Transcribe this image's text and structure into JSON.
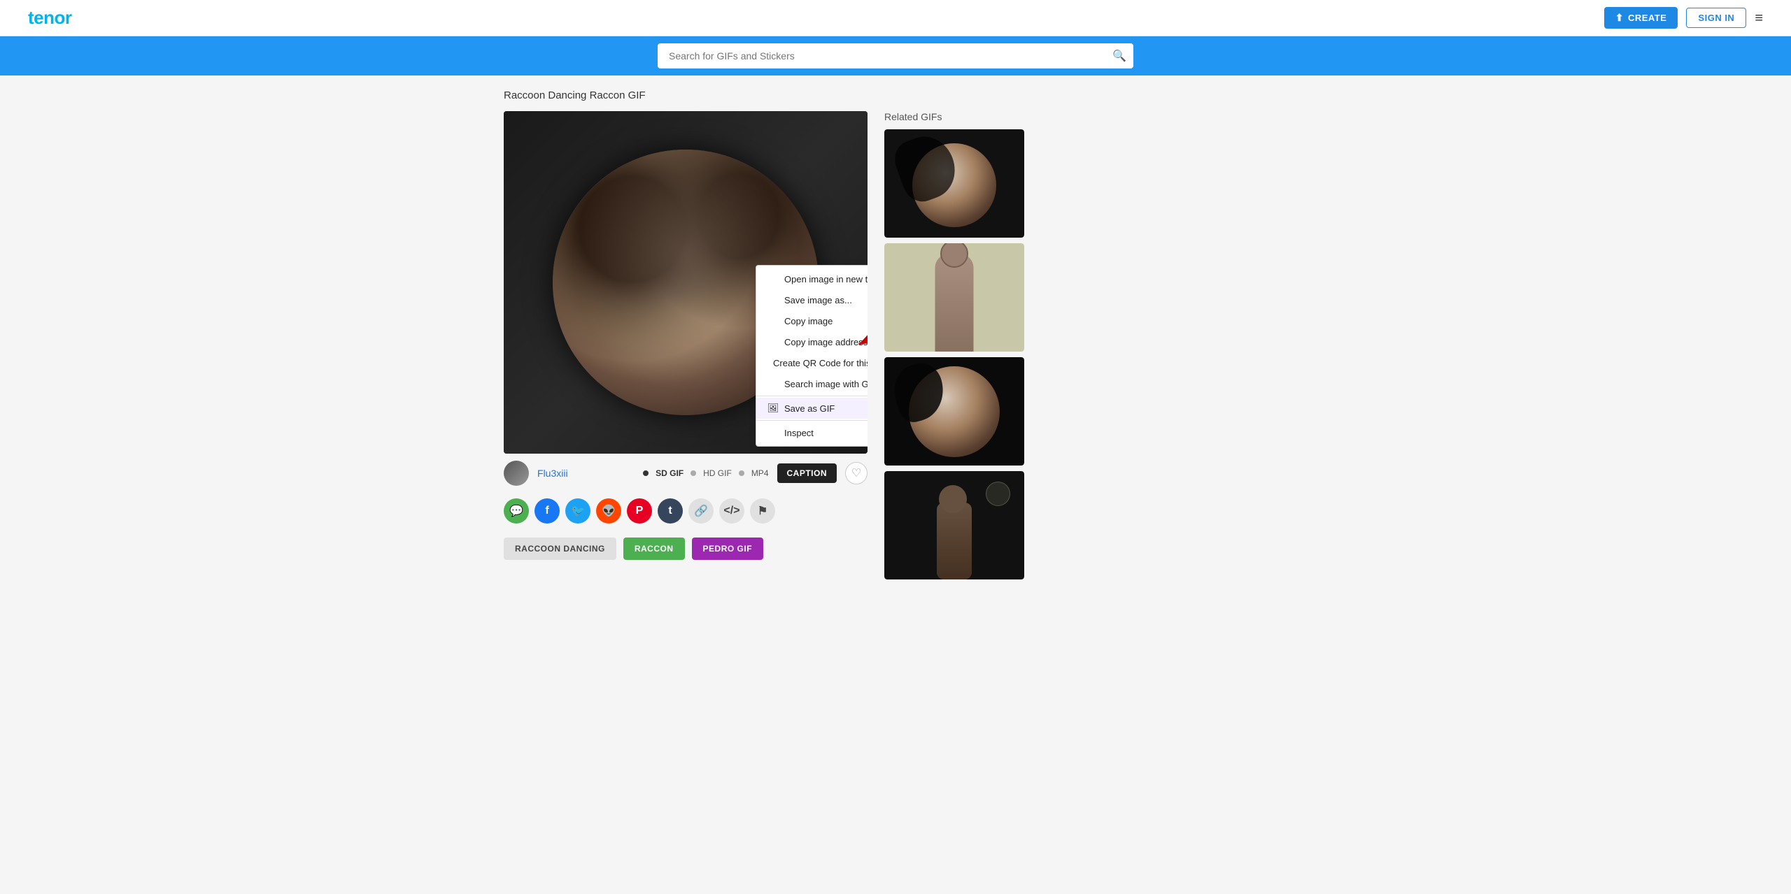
{
  "header": {
    "logo": "tenor",
    "create_label": "CREATE",
    "signin_label": "SIGN IN"
  },
  "search": {
    "placeholder": "Search for GIFs and Stickers"
  },
  "page": {
    "title": "Raccoon Dancing Raccon GIF"
  },
  "gif_info": {
    "username": "Flu3xiii",
    "format_sd": "SD GIF",
    "format_hd": "HD GIF",
    "format_mp4": "MP4",
    "caption_label": "CAPTION"
  },
  "share_buttons": [
    {
      "name": "messages",
      "symbol": "💬",
      "class": "messages"
    },
    {
      "name": "facebook",
      "symbol": "f",
      "class": "facebook"
    },
    {
      "name": "twitter",
      "symbol": "🐦",
      "class": "twitter"
    },
    {
      "name": "reddit",
      "symbol": "👽",
      "class": "reddit"
    },
    {
      "name": "pinterest",
      "symbol": "P",
      "class": "pinterest"
    },
    {
      "name": "tumblr",
      "symbol": "t",
      "class": "tumblr"
    },
    {
      "name": "link",
      "symbol": "🔗",
      "class": "link"
    },
    {
      "name": "embed",
      "symbol": "</>",
      "class": "embed"
    },
    {
      "name": "flag",
      "symbol": "⚑",
      "class": "flag"
    }
  ],
  "tags": [
    {
      "label": "RACCOON DANCING",
      "style": "default"
    },
    {
      "label": "RACCON",
      "style": "green"
    },
    {
      "label": "PEDRO GIF",
      "style": "purple"
    }
  ],
  "related": {
    "title": "Related GIFs"
  },
  "context_menu": {
    "items": [
      {
        "label": "Open image in new tab",
        "icon": "",
        "highlighted": false
      },
      {
        "label": "Save image as...",
        "icon": "",
        "highlighted": false
      },
      {
        "label": "Copy image",
        "icon": "",
        "highlighted": false
      },
      {
        "label": "Copy image address",
        "icon": "",
        "highlighted": false
      },
      {
        "label": "Create QR Code for this image",
        "icon": "",
        "highlighted": false
      },
      {
        "label": "Search image with Google",
        "icon": "",
        "highlighted": false
      },
      {
        "label": "Save as GIF",
        "icon": "🖼",
        "highlighted": true
      },
      {
        "label": "Inspect",
        "icon": "",
        "highlighted": false
      }
    ]
  }
}
